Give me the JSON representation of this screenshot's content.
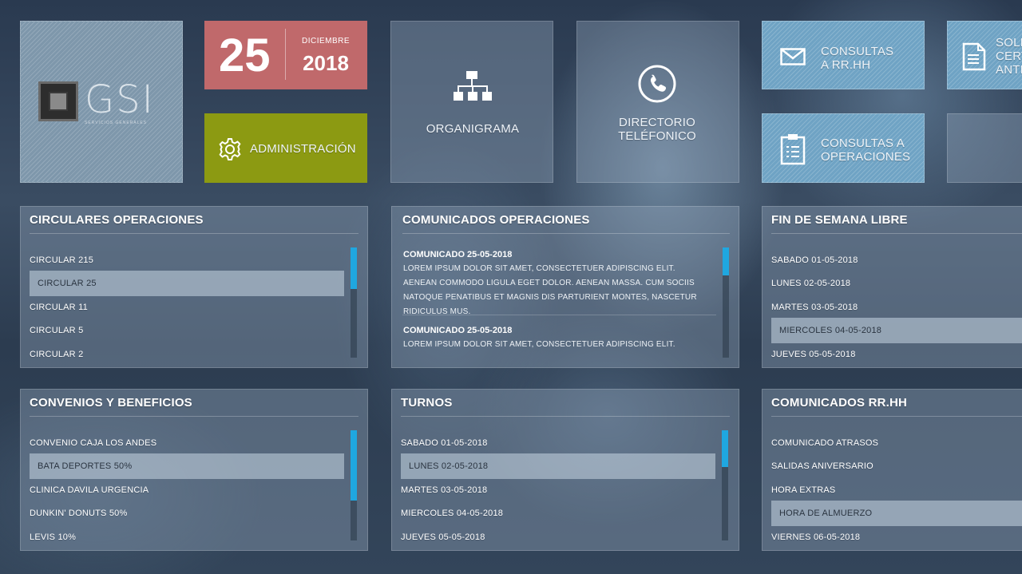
{
  "tiles": {
    "logo": {
      "text": "GSI",
      "subtitle": "SERVICIOS GENERALES"
    },
    "date": {
      "day": "25",
      "month": "DICIEMBRE",
      "year": "2018"
    },
    "admin": {
      "label": "ADMINISTRACIÓN"
    },
    "organigrama": {
      "label": "ORGANIGRAMA"
    },
    "directorio": {
      "line1": "DIRECTORIO",
      "line2": "TELÉFONICO"
    },
    "consultas_rrhh": {
      "line1": "CONSULTAS",
      "line2": "A RR.HH"
    },
    "consultas_ops": {
      "line1": "CONSULTAS A",
      "line2": "OPERACIONES"
    },
    "solicitud": {
      "line1": "SOLIC",
      "line2": "CERT",
      "line3": "ANTI"
    }
  },
  "panels": {
    "circulares": {
      "title": "CIRCULARES OPERACIONES",
      "items": [
        "CIRCULAR 215",
        "CIRCULAR 25",
        "CIRCULAR 11",
        "CIRCULAR 5",
        "CIRCULAR 2"
      ]
    },
    "comunicados_ops": {
      "title": "COMUNICADOS OPERACIONES",
      "entries": [
        {
          "title": "COMUNICADO 25-05-2018",
          "body": "LOREM IPSUM DOLOR SIT AMET, CONSECTETUER ADIPISCING ELIT. AENEAN COMMODO LIGULA EGET DOLOR. AENEAN MASSA. CUM SOCIIS NATOQUE PENATIBUS ET MAGNIS DIS PARTURIENT MONTES, NASCETUR RIDICULUS MUS."
        },
        {
          "title": "COMUNICADO 25-05-2018",
          "body": "LOREM IPSUM DOLOR SIT AMET, CONSECTETUER ADIPISCING ELIT. AENEAN"
        }
      ]
    },
    "fin_semana": {
      "title": "FIN DE SEMANA LIBRE",
      "items": [
        "SABADO 01-05-2018",
        "LUNES 02-05-2018",
        "MARTES 03-05-2018",
        "MIERCOLES 04-05-2018",
        "JUEVES 05-05-2018"
      ]
    },
    "convenios": {
      "title": "CONVENIOS Y BENEFICIOS",
      "items": [
        "CONVENIO CAJA LOS ANDES",
        "BATA DEPORTES 50%",
        "CLINICA DAVILA URGENCIA",
        "DUNKIN' DONUTS 50%",
        "LEVIS 10%"
      ]
    },
    "turnos": {
      "title": "TURNOS",
      "items": [
        "SABADO 01-05-2018",
        "LUNES 02-05-2018",
        "MARTES 03-05-2018",
        "MIERCOLES 04-05-2018",
        "JUEVES 05-05-2018"
      ]
    },
    "comunicados_rrhh": {
      "title": "COMUNICADOS RR.HH",
      "items": [
        "COMUNICADO ATRASOS",
        "SALIDAS ANIVERSARIO",
        "HORA EXTRAS",
        "HORA DE ALMUERZO",
        "VIERNES 06-05-2018"
      ]
    }
  },
  "colors": {
    "date_tile": "#c0696b",
    "admin_tile": "#8c9a12",
    "scroll_accent": "#1fa7e0",
    "consult_tile": "#6fa3c4"
  },
  "icons": [
    "gear-icon",
    "org-chart-icon",
    "phone-icon",
    "mail-icon",
    "document-icon",
    "clipboard-icon"
  ]
}
